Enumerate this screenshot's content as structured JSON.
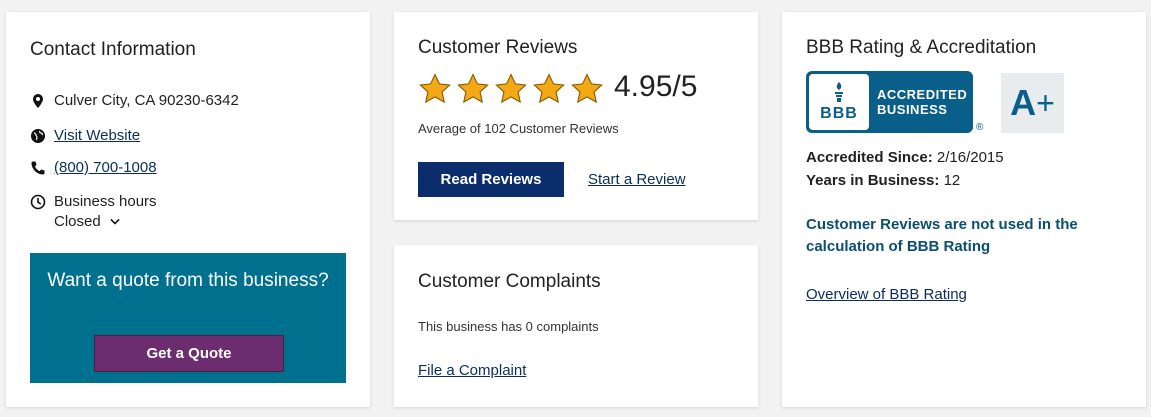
{
  "contact": {
    "title": "Contact Information",
    "address": "Culver City, CA 90230-6342",
    "website": "Visit Website",
    "phone": "(800) 700-1008",
    "hours_label": "Business hours",
    "hours_status": "Closed",
    "quote_text": "Want a quote from this business?",
    "quote_button": "Get a Quote"
  },
  "reviews": {
    "title": "Customer Reviews",
    "rating": "4.95/5",
    "stars": 5,
    "average_text": "Average of 102 Customer Reviews",
    "read_button": "Read Reviews",
    "start_link": "Start a Review"
  },
  "complaints": {
    "title": "Customer Complaints",
    "summary": "This business has 0 complaints",
    "file_link": "File a Complaint"
  },
  "bbb": {
    "title": "BBB Rating & Accreditation",
    "logo_line1": "ACCREDITED",
    "logo_line2": "BUSINESS",
    "logo_seal": "BBB",
    "registered_mark": "®",
    "grade": "A",
    "grade_modifier": "+",
    "accredited_since_label": "Accredited Since:",
    "accredited_since_value": "2/16/2015",
    "years_label": "Years in Business:",
    "years_value": "12",
    "note": "Customer Reviews are not used in the calculation of BBB Rating",
    "overview_link": "Overview of BBB Rating"
  },
  "colors": {
    "star": "#f5a815",
    "quote_bg": "#00708f",
    "quote_button": "#6b2d6e",
    "read_button": "#0b2d6b",
    "bbb_blue": "#0a5e8a"
  },
  "icons": [
    "location-pin-icon",
    "globe-icon",
    "phone-icon",
    "clock-icon",
    "chevron-down-icon",
    "star-icon"
  ]
}
